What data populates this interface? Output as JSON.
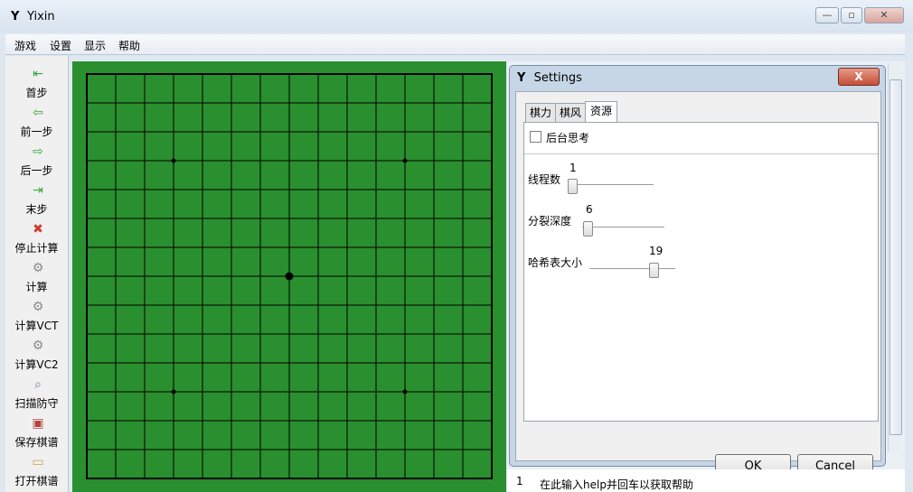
{
  "window": {
    "title": "Yixin",
    "icon": "Y"
  },
  "window_controls": {
    "minimize": "—",
    "maximize": "▫",
    "close": "✕"
  },
  "menu": [
    "游戏",
    "设置",
    "显示",
    "帮助"
  ],
  "toolbar": [
    {
      "label": "首步",
      "icon": "first-step-icon",
      "glyph": "⇤",
      "color": "#3ba63b"
    },
    {
      "label": "前一步",
      "icon": "previous-step-icon",
      "glyph": "⇦",
      "color": "#3ba63b"
    },
    {
      "label": "后一步",
      "icon": "next-step-icon",
      "glyph": "⇨",
      "color": "#3ba63b"
    },
    {
      "label": "末步",
      "icon": "last-step-icon",
      "glyph": "⇥",
      "color": "#3ba63b"
    },
    {
      "label": "停止计算",
      "icon": "stop-icon",
      "glyph": "✖",
      "color": "#d23b2b"
    },
    {
      "label": "计算",
      "icon": "gear-icon",
      "glyph": "⚙",
      "color": "#8a8a8a"
    },
    {
      "label": "计算VCT",
      "icon": "gear-icon",
      "glyph": "⚙",
      "color": "#8a8a8a"
    },
    {
      "label": "计算VC2",
      "icon": "gear-icon",
      "glyph": "⚙",
      "color": "#8a8a8a"
    },
    {
      "label": "扫描防守",
      "icon": "magnifier-icon",
      "glyph": "⌕",
      "color": "#6a7f99"
    },
    {
      "label": "保存棋谱",
      "icon": "save-icon",
      "glyph": "▣",
      "color": "#b5413b"
    },
    {
      "label": "打开棋谱",
      "icon": "open-folder-icon",
      "glyph": "▭",
      "color": "#c9a44a"
    }
  ],
  "board": {
    "size": 15,
    "star_points": [
      [
        3,
        3
      ],
      [
        11,
        3
      ],
      [
        7,
        7
      ],
      [
        3,
        11
      ],
      [
        11,
        11
      ]
    ],
    "color": "#2a8f2e",
    "line_color": "#000000"
  },
  "dialog": {
    "title": "Settings",
    "close": "X",
    "tabs": [
      "棋力",
      "棋风",
      "资源"
    ],
    "active_tab": "资源",
    "checkbox": {
      "label": "后台思考",
      "checked": false
    },
    "sliders": [
      {
        "label": "线程数",
        "value": "1"
      },
      {
        "label": "分裂深度",
        "value": "6"
      },
      {
        "label": "哈希表大小",
        "value": "19"
      }
    ],
    "ok": "OK",
    "cancel": "Cancel"
  },
  "console": {
    "line_number": "1",
    "hint": "在此输入help并回车以获取帮助"
  }
}
